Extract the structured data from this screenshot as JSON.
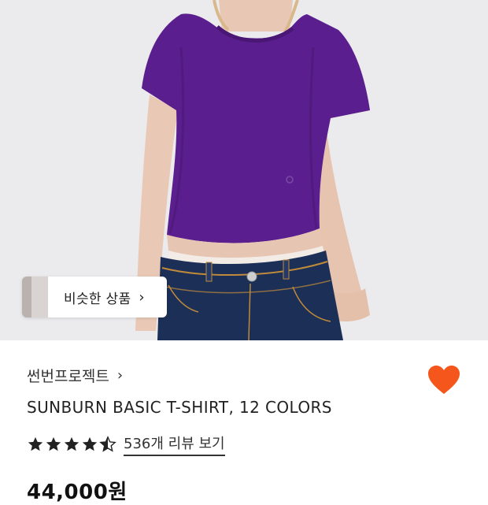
{
  "similar_products": {
    "label": "비슷한 상품",
    "chevron": "›"
  },
  "product": {
    "brand": "썬번프로젝트",
    "brand_chevron": "›",
    "title": "SUNBURN BASIC T-SHIRT, 12 COLORS",
    "rating": 4.5,
    "review_link": "536개 리뷰 보기",
    "price": "44,000원"
  },
  "icons": {
    "wishlist": "heart-icon",
    "rating": "star-icon"
  },
  "colors": {
    "heart": "#f5561b",
    "shirt": "#5b1e8f",
    "jeans": "#1c2f57"
  }
}
